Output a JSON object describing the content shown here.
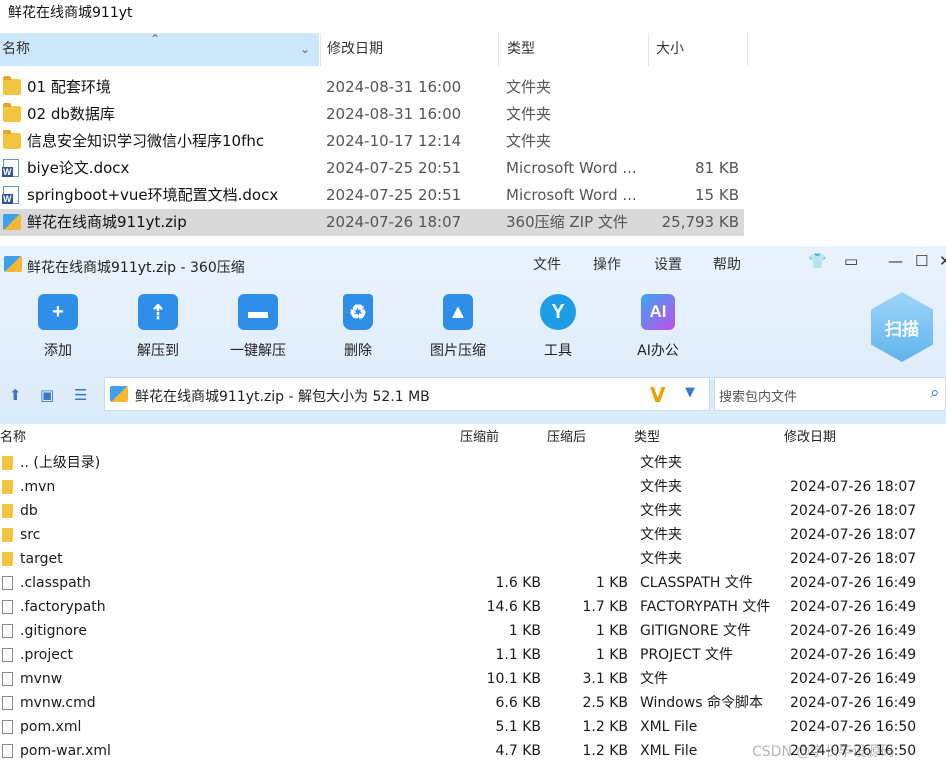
{
  "explorer": {
    "title": "鲜花在线商城911yt",
    "headers": {
      "name": "名称",
      "date": "修改日期",
      "type": "类型",
      "size": "大小"
    },
    "rows": [
      {
        "icon": "folder-icon",
        "name": "01 配套环境",
        "date": "2024-08-31 16:00",
        "type": "文件夹",
        "size": ""
      },
      {
        "icon": "folder-icon",
        "name": "02 db数据库",
        "date": "2024-08-31 16:00",
        "type": "文件夹",
        "size": ""
      },
      {
        "icon": "folder-icon",
        "name": "信息安全知识学习微信小程序10fhc",
        "date": "2024-10-17 12:14",
        "type": "文件夹",
        "size": ""
      },
      {
        "icon": "word-doc-icon",
        "name": "biye论文.docx",
        "date": "2024-07-25 20:51",
        "type": "Microsoft Word ...",
        "size": "81 KB"
      },
      {
        "icon": "word-doc-icon",
        "name": "springboot+vue环境配置文档.docx",
        "date": "2024-07-25 20:51",
        "type": "Microsoft Word ...",
        "size": "15 KB"
      },
      {
        "icon": "zip-icon",
        "name": "鲜花在线商城911yt.zip",
        "date": "2024-07-26 18:07",
        "type": "360压缩 ZIP 文件",
        "size": "25,793 KB",
        "selected": true
      }
    ]
  },
  "zip": {
    "title": "鲜花在线商城911yt.zip - 360压缩",
    "menu": {
      "file": "文件",
      "operate": "操作",
      "settings": "设置",
      "help": "帮助"
    },
    "toolbar": {
      "add": "添加",
      "extract": "解压到",
      "oneclick": "一键解压",
      "delete": "删除",
      "imgzip": "图片压缩",
      "tools": "工具",
      "ai": "AI办公",
      "scan": "扫描"
    },
    "address": "鲜花在线商城911yt.zip - 解包大小为 52.1 MB",
    "search_placeholder": "搜索包内文件",
    "headers": {
      "name": "名称",
      "before": "压缩前",
      "after": "压缩后",
      "type": "类型",
      "date": "修改日期"
    },
    "rows": [
      {
        "icon": "folder-icon",
        "name": ".. (上级目录)",
        "before": "",
        "after": "",
        "type": "文件夹",
        "date": ""
      },
      {
        "icon": "folder-icon",
        "name": ".mvn",
        "before": "",
        "after": "",
        "type": "文件夹",
        "date": "2024-07-26 18:07"
      },
      {
        "icon": "folder-icon",
        "name": "db",
        "before": "",
        "after": "",
        "type": "文件夹",
        "date": "2024-07-26 18:07"
      },
      {
        "icon": "folder-icon",
        "name": "src",
        "before": "",
        "after": "",
        "type": "文件夹",
        "date": "2024-07-26 18:07"
      },
      {
        "icon": "folder-icon",
        "name": "target",
        "before": "",
        "after": "",
        "type": "文件夹",
        "date": "2024-07-26 18:07"
      },
      {
        "icon": "file-icon",
        "name": ".classpath",
        "before": "1.6 KB",
        "after": "1 KB",
        "type": "CLASSPATH 文件",
        "date": "2024-07-26 16:49"
      },
      {
        "icon": "file-icon",
        "name": ".factorypath",
        "before": "14.6 KB",
        "after": "1.7 KB",
        "type": "FACTORYPATH 文件",
        "date": "2024-07-26 16:49"
      },
      {
        "icon": "file-icon",
        "name": ".gitignore",
        "before": "1 KB",
        "after": "1 KB",
        "type": "GITIGNORE 文件",
        "date": "2024-07-26 16:49"
      },
      {
        "icon": "file-icon",
        "name": ".project",
        "before": "1.1 KB",
        "after": "1 KB",
        "type": "PROJECT 文件",
        "date": "2024-07-26 16:49"
      },
      {
        "icon": "file-icon",
        "name": "mvnw",
        "before": "10.1 KB",
        "after": "3.1 KB",
        "type": "文件",
        "date": "2024-07-26 16:49"
      },
      {
        "icon": "cmd-file-icon",
        "name": "mvnw.cmd",
        "before": "6.6 KB",
        "after": "2.5 KB",
        "type": "Windows 命令脚本",
        "date": "2024-07-26 16:49"
      },
      {
        "icon": "file-icon",
        "name": "pom.xml",
        "before": "5.1 KB",
        "after": "1.2 KB",
        "type": "XML File",
        "date": "2024-07-26 16:50"
      },
      {
        "icon": "file-icon",
        "name": "pom-war.xml",
        "before": "4.7 KB",
        "after": "1.2 KB",
        "type": "XML File",
        "date": "2024-07-26 16:50"
      }
    ]
  },
  "watermark": "CSDN @学长毕设源码"
}
